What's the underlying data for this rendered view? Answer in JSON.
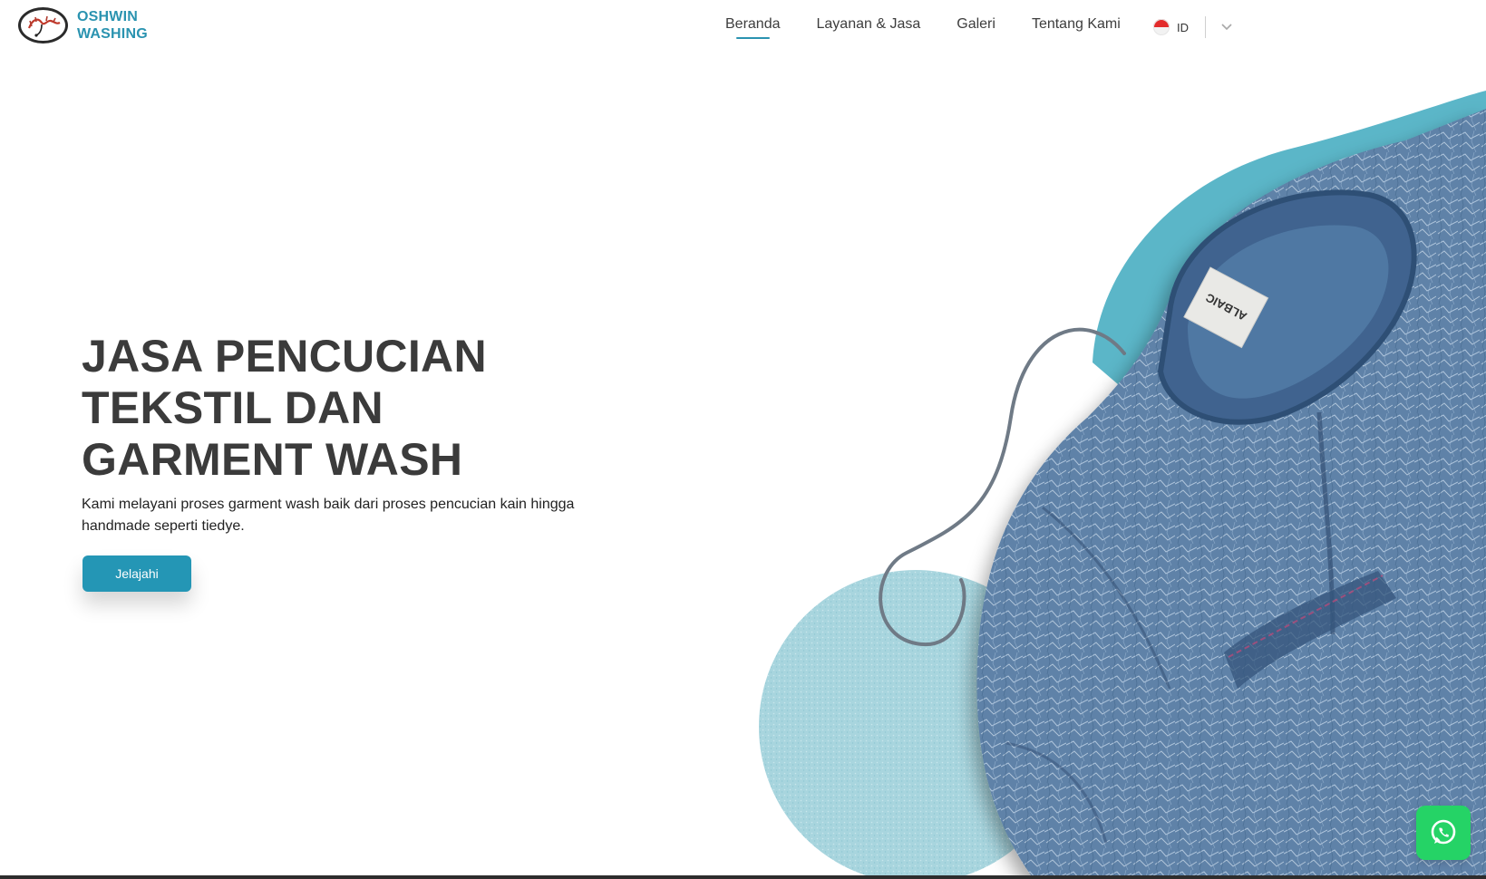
{
  "brand": {
    "line1": "OSHWIN",
    "line2": "WASHING",
    "logo_icon": "dragon-logo-icon"
  },
  "nav": {
    "items": [
      {
        "label": "Beranda",
        "active": true
      },
      {
        "label": "Layanan & Jasa",
        "active": false
      },
      {
        "label": "Galeri",
        "active": false
      },
      {
        "label": "Tentang Kami",
        "active": false
      }
    ]
  },
  "language": {
    "code": "ID",
    "flag_icon": "indonesia-flag-icon",
    "dropdown_icon": "chevron-down-icon"
  },
  "hero": {
    "title": "JASA PENCUCIAN TEKSTIL DAN GARMENT WASH",
    "description": "Kami melayani proses garment wash baik dari proses pencucian kain hingga handmade seperti tiedye.",
    "cta_label": "Jelajahi",
    "image_icon": "denim-shirt-image",
    "label_text": "ALBAIC"
  },
  "floating": {
    "whatsapp_icon": "whatsapp-icon"
  },
  "colors": {
    "accent": "#2496b5",
    "brand_text": "#2a93b0",
    "blob": "#5bb6c8",
    "circle": "#a9d6df",
    "whatsapp": "#25d366"
  }
}
